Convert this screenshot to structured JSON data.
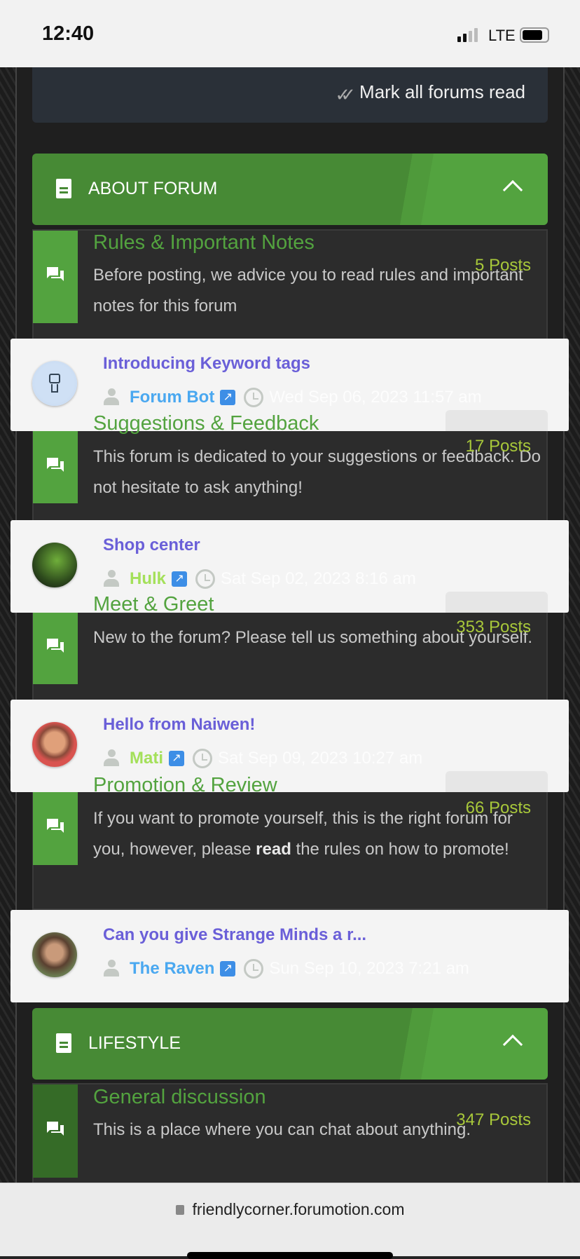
{
  "status_bar": {
    "time": "12:40",
    "network": "LTE"
  },
  "toolbar": {
    "mark_all_label": "Mark all forums read",
    "mark_icon": "double-check-icon"
  },
  "categories": [
    {
      "label": "ABOUT FORUM",
      "icon": "document-icon",
      "collapse_icon": "chevron-up-icon"
    },
    {
      "label": "LIFESTYLE",
      "icon": "document-icon",
      "collapse_icon": "chevron-up-icon"
    }
  ],
  "forums": [
    {
      "title": "Rules & Important Notes",
      "desc": "Before posting, we advice you to read rules and important notes for this forum",
      "posts": "5 Posts"
    },
    {
      "title": "Suggestions & Feedback",
      "desc": "This forum is dedicated to your suggestions or feedback. Do not hesitate to ask anything!",
      "posts": "17 Posts"
    },
    {
      "title": "Meet & Greet",
      "desc": "New to the forum? Please tell us something about yourself.",
      "posts": "353 Posts"
    },
    {
      "title": "Promotion & Review",
      "desc_pre": "If you want to promote yourself, this is the right forum for you, however, please ",
      "desc_bold": "read",
      "desc_post": " the rules on how to promote!",
      "posts": "66 Posts"
    },
    {
      "title": "General discussion",
      "desc": "This is a place where you can chat about anything.",
      "posts": "347 Posts"
    }
  ],
  "last_posts": [
    {
      "topic": "Introducing Keyword tags",
      "user": "Forum Bot",
      "user_color": "#4aa8f0",
      "date": "Wed Sep 06, 2023 11:57 am"
    },
    {
      "topic": "Shop center",
      "user": "Hulk",
      "user_color": "#a4e05a",
      "date": "Sat Sep 02, 2023 8:16 am"
    },
    {
      "topic": "Hello from Naiwen!",
      "user": "Mati",
      "user_color": "#a4e05a",
      "date": "Sat Sep 09, 2023 10:27 am"
    },
    {
      "topic": "Can you give Strange Minds a r...",
      "user": "The Raven",
      "user_color": "#4aa8f0",
      "date": "Sun Sep 10, 2023 7:21 am"
    }
  ],
  "browser": {
    "url": "friendlycorner.forumotion.com"
  },
  "colors": {
    "accent": "#53a33f",
    "topic": "#6a5fd8",
    "posts": "#a8c83a"
  }
}
